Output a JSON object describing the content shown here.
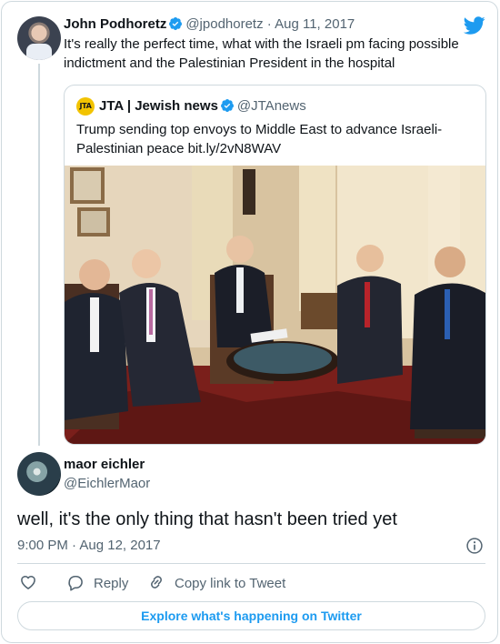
{
  "tweet": {
    "author_name": "John Podhoretz",
    "author_handle": "@jpodhoretz",
    "separator": "·",
    "date": "Aug 11, 2017",
    "text": "It's really the perfect time, what with the Israeli pm facing possible indictment and the Palestinian President in the hospital",
    "verified": true
  },
  "quoted": {
    "author_name": "JTA | Jewish news",
    "author_handle": "@JTAnews",
    "avatar_text": "JTA",
    "text": "Trump sending top envoys to Middle East to advance Israeli-Palestinian peace bit.ly/2vN8WAV",
    "verified": true
  },
  "reply": {
    "author_name": "maor eichler",
    "author_handle": "@EichlerMaor",
    "text": "well, it's the only thing that hasn't been tried yet",
    "timestamp": "9:00 PM · Aug 12, 2017"
  },
  "actions": {
    "like_label": "",
    "reply_label": "Reply",
    "copy_link_label": "Copy link to Tweet"
  },
  "explore_label": "Explore what's happening on Twitter",
  "colors": {
    "twitter_blue": "#1d9bf0",
    "text_primary": "#0f1419",
    "text_secondary": "#536471",
    "border": "#cfd9de",
    "jta_yellow": "#f2c300"
  },
  "icons": [
    "twitter-logo-icon",
    "verified-badge-icon",
    "info-icon",
    "heart-icon",
    "reply-icon",
    "link-icon"
  ]
}
